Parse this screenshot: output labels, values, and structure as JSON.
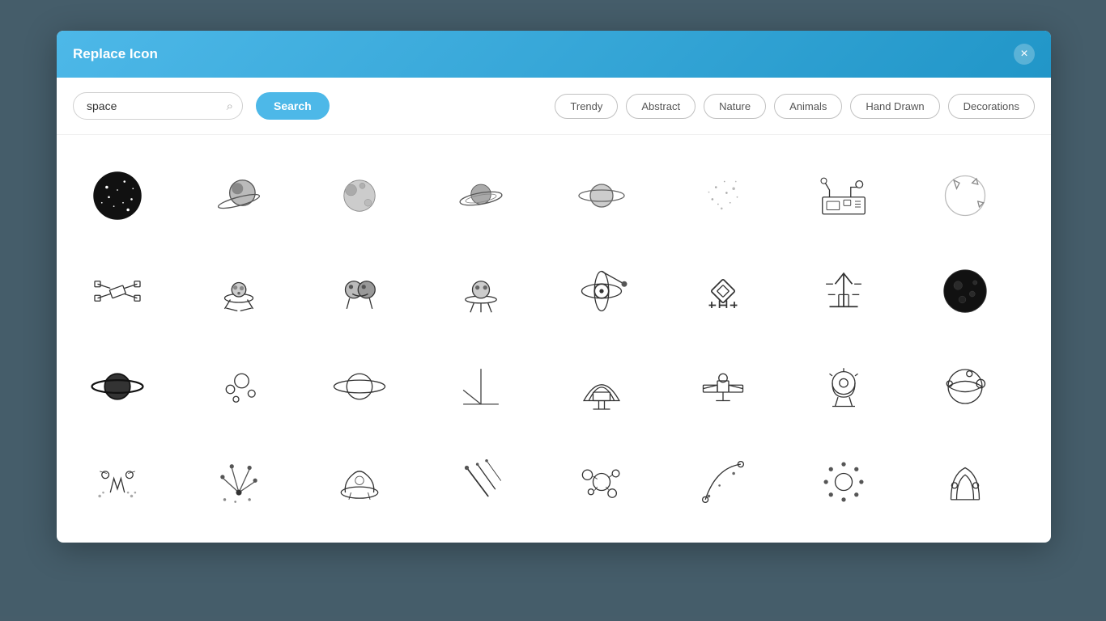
{
  "modal": {
    "title": "Replace Icon",
    "close_label": "×"
  },
  "search": {
    "value": "space",
    "placeholder": "space",
    "button_label": "Search",
    "icon": "🔍"
  },
  "filters": [
    {
      "id": "trendy",
      "label": "Trendy",
      "active": false
    },
    {
      "id": "abstract",
      "label": "Abstract",
      "active": false
    },
    {
      "id": "nature",
      "label": "Nature",
      "active": false
    },
    {
      "id": "animals",
      "label": "Animals",
      "active": false
    },
    {
      "id": "hand-drawn",
      "label": "Hand Drawn",
      "active": false
    },
    {
      "id": "decorations",
      "label": "Decorations",
      "active": false
    }
  ],
  "icons": [
    {
      "id": "icon-1",
      "name": "space-galaxy-circle"
    },
    {
      "id": "icon-2",
      "name": "planet-saturn"
    },
    {
      "id": "icon-3",
      "name": "planet-moon"
    },
    {
      "id": "icon-4",
      "name": "planet-rings"
    },
    {
      "id": "icon-5",
      "name": "planet-orbit"
    },
    {
      "id": "icon-6",
      "name": "stardust"
    },
    {
      "id": "icon-7",
      "name": "space-desk"
    },
    {
      "id": "icon-8",
      "name": "space-rocket-globe"
    },
    {
      "id": "icon-9",
      "name": "satellite"
    },
    {
      "id": "icon-10",
      "name": "ufo-alien"
    },
    {
      "id": "icon-11",
      "name": "alien-creature"
    },
    {
      "id": "icon-12",
      "name": "ufo-floating"
    },
    {
      "id": "icon-13",
      "name": "atom-space"
    },
    {
      "id": "icon-14",
      "name": "space-geometric"
    },
    {
      "id": "icon-15",
      "name": "space-monument"
    },
    {
      "id": "icon-16",
      "name": "dark-planet"
    },
    {
      "id": "icon-17",
      "name": "saturn-bold"
    },
    {
      "id": "icon-18",
      "name": "space-bubbles"
    },
    {
      "id": "icon-19",
      "name": "planet-ring-outline"
    },
    {
      "id": "icon-20",
      "name": "axis-cross"
    },
    {
      "id": "icon-21",
      "name": "space-dome"
    },
    {
      "id": "icon-22",
      "name": "space-station"
    },
    {
      "id": "icon-23",
      "name": "space-rover"
    },
    {
      "id": "icon-24",
      "name": "planet-stripes"
    },
    {
      "id": "icon-25",
      "name": "space-rockets-small"
    },
    {
      "id": "icon-26",
      "name": "fireworks-space"
    },
    {
      "id": "icon-27",
      "name": "planet-surface"
    },
    {
      "id": "icon-28",
      "name": "meteors"
    },
    {
      "id": "icon-29",
      "name": "space-planets-cluster"
    },
    {
      "id": "icon-30",
      "name": "space-orbit-curve"
    },
    {
      "id": "icon-31",
      "name": "space-stars-ring"
    },
    {
      "id": "icon-32",
      "name": "space-arch"
    }
  ]
}
